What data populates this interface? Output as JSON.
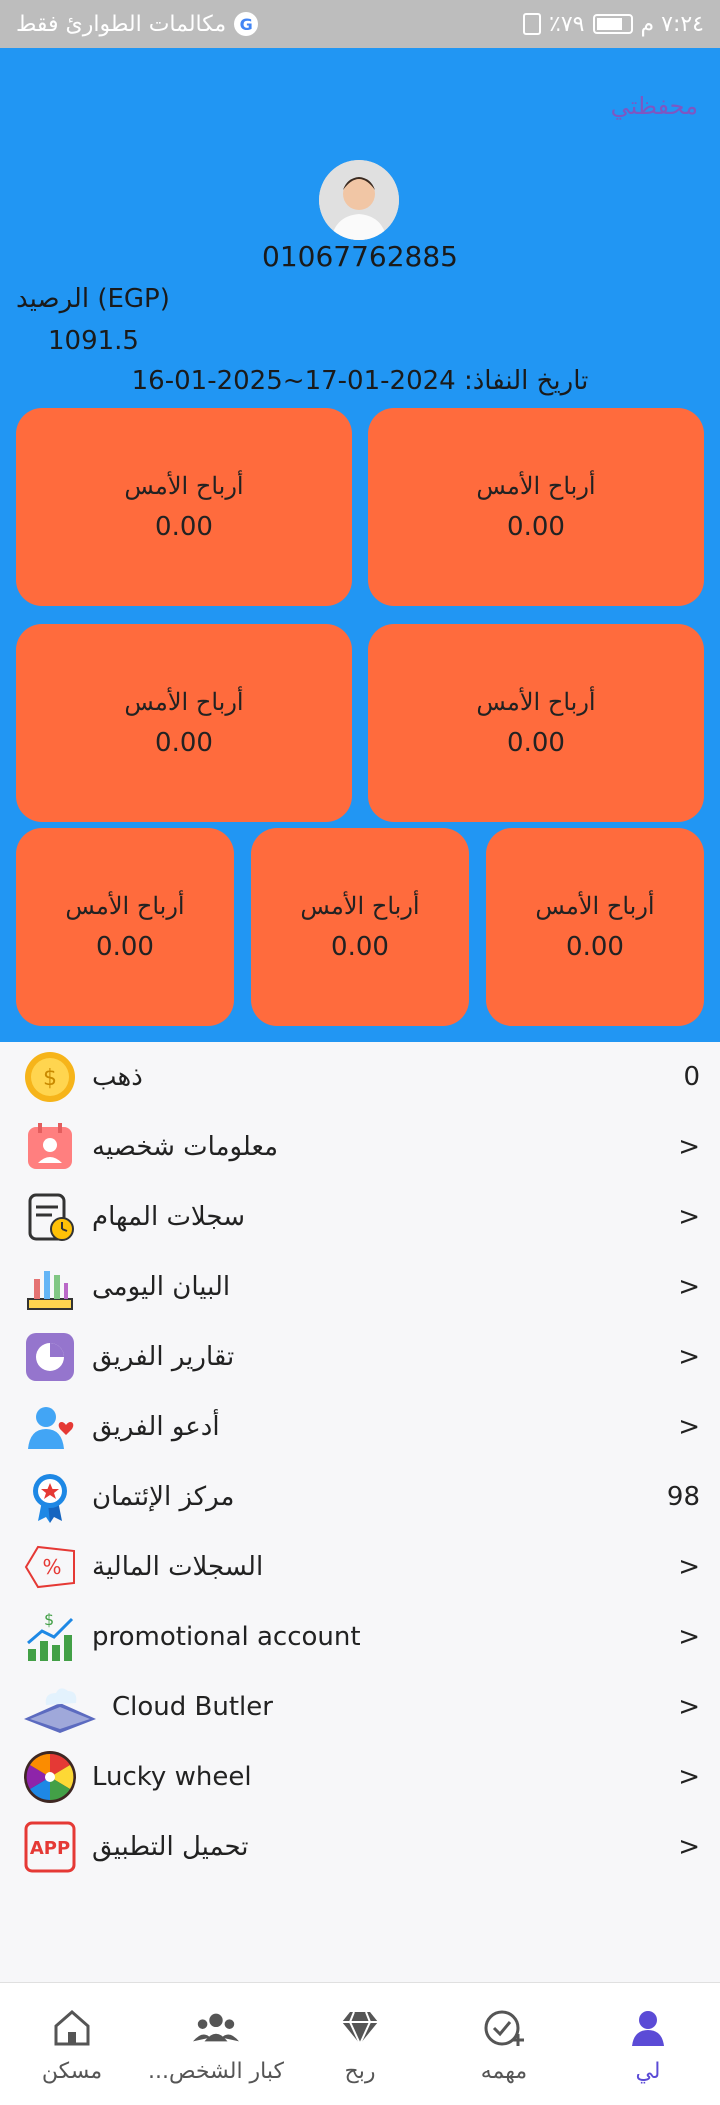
{
  "status_bar": {
    "carrier_text": "مكالمات الطوارئ فقط",
    "battery_percent_text": "٧٩٪",
    "time": "٧:٢٤ م"
  },
  "header": {
    "wallet_label": "محفظتي",
    "phone": "01067762885",
    "balance_label": "الرصيد (EGP)",
    "balance_value": "1091.5",
    "validity": "تاريخ النفاذ: 2024-01-17~2025-01-16"
  },
  "cards": [
    {
      "title": "أرباح الأمس",
      "value": "0.00"
    },
    {
      "title": "أرباح الأمس",
      "value": "0.00"
    },
    {
      "title": "أرباح الأمس",
      "value": "0.00"
    },
    {
      "title": "أرباح الأمس",
      "value": "0.00"
    },
    {
      "title": "أرباح الأمس",
      "value": "0.00"
    },
    {
      "title": "أرباح الأمس",
      "value": "0.00"
    },
    {
      "title": "أرباح الأمس",
      "value": "0.00"
    }
  ],
  "menu": [
    {
      "icon": "gold-coin-icon",
      "label": "ذهب",
      "right": "0"
    },
    {
      "icon": "profile-card-icon",
      "label": "معلومات شخصيه",
      "right": ">"
    },
    {
      "icon": "task-log-icon",
      "label": "سجلات المهام",
      "right": ">"
    },
    {
      "icon": "daily-chart-icon",
      "label": "البيان اليومى",
      "right": ">"
    },
    {
      "icon": "team-report-icon",
      "label": "تقارير الفريق",
      "right": ">"
    },
    {
      "icon": "invite-team-icon",
      "label": "أدعو الفريق",
      "right": ">"
    },
    {
      "icon": "credit-badge-icon",
      "label": "مركز الإئتمان",
      "right": "98"
    },
    {
      "icon": "percent-tag-icon",
      "label": "السجلات المالية",
      "right": ">"
    },
    {
      "icon": "promo-chart-icon",
      "label": "promotional account",
      "right": ">"
    },
    {
      "icon": "cloud-butler-icon",
      "label": "Cloud Butler",
      "right": ">"
    },
    {
      "icon": "lucky-wheel-icon",
      "label": "Lucky wheel",
      "right": ">"
    },
    {
      "icon": "app-download-icon",
      "label": "تحميل التطبيق",
      "right": ">"
    }
  ],
  "bottom_nav": [
    {
      "icon": "home-icon",
      "label": "مسكن"
    },
    {
      "icon": "team-icon",
      "label": "...كبار الشخص"
    },
    {
      "icon": "diamond-icon",
      "label": "ربح"
    },
    {
      "icon": "task-check-icon",
      "label": "مهمه"
    },
    {
      "icon": "user-icon",
      "label": "لي"
    }
  ],
  "colors": {
    "hero_bg": "#2196f3",
    "card_bg": "#ff6b3d",
    "accent": "#5b4bd6"
  }
}
